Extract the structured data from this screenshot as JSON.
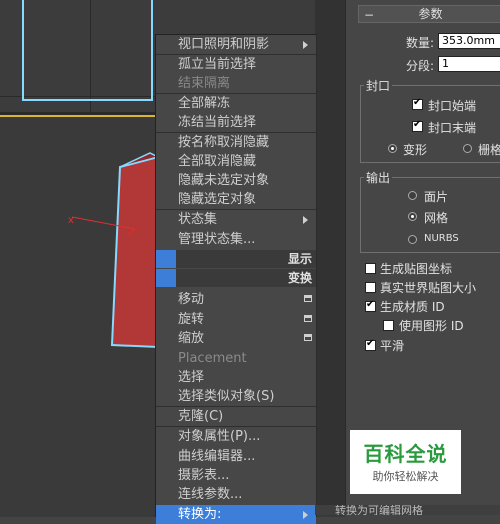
{
  "context_menu": {
    "items": [
      {
        "label": "视口照明和阴影",
        "submenu": true
      },
      {
        "label": "孤立当前选择"
      },
      {
        "label": "结束隔离",
        "disabled": true
      },
      {
        "label": "全部解冻"
      },
      {
        "label": "冻结当前选择"
      },
      {
        "label": "按名称取消隐藏"
      },
      {
        "label": "全部取消隐藏"
      },
      {
        "label": "隐藏未选定对象"
      },
      {
        "label": "隐藏选定对象"
      },
      {
        "label": "状态集",
        "submenu": true
      },
      {
        "label": "管理状态集..."
      }
    ],
    "quad_display": "显示",
    "quad_transform": "变换",
    "transform_items": [
      {
        "label": "移动",
        "settings": true
      },
      {
        "label": "旋转",
        "settings": true
      },
      {
        "label": "缩放",
        "settings": true
      },
      {
        "label": "Placement",
        "disabled": true
      },
      {
        "label": "选择"
      },
      {
        "label": "选择类似对象(S)"
      },
      {
        "label": "克隆(C)"
      },
      {
        "label": "对象属性(P)..."
      },
      {
        "label": "曲线编辑器..."
      },
      {
        "label": "摄影表..."
      },
      {
        "label": "连线参数..."
      },
      {
        "label": "转换为:",
        "submenu": true
      }
    ]
  },
  "tooltip": "转换为可编辑网格",
  "panel": {
    "rollout_title": "参数",
    "amount_label": "数量:",
    "amount_value": "353.0mm",
    "segments_label": "分段:",
    "segments_value": "1",
    "capping_group": "封口",
    "cap_start": "封口始端",
    "cap_end": "封口末端",
    "morph": "变形",
    "grid": "栅格",
    "output_group": "输出",
    "patch": "面片",
    "mesh": "网格",
    "nurbs": "NURBS",
    "gen_mapping": "生成贴图坐标",
    "real_world": "真实世界贴图大小",
    "gen_mat_ids": "生成材质 ID",
    "use_shape_ids": "使用图形 ID",
    "smooth": "平滑"
  },
  "watermark": {
    "title": "百科全说",
    "subtitle": "助你轻松解决"
  },
  "colors": {
    "accent": "#3d7fd8",
    "selection": "#86d9ff",
    "viewport_border": "#d8b437",
    "watermark_green": "#2b9a3e"
  }
}
